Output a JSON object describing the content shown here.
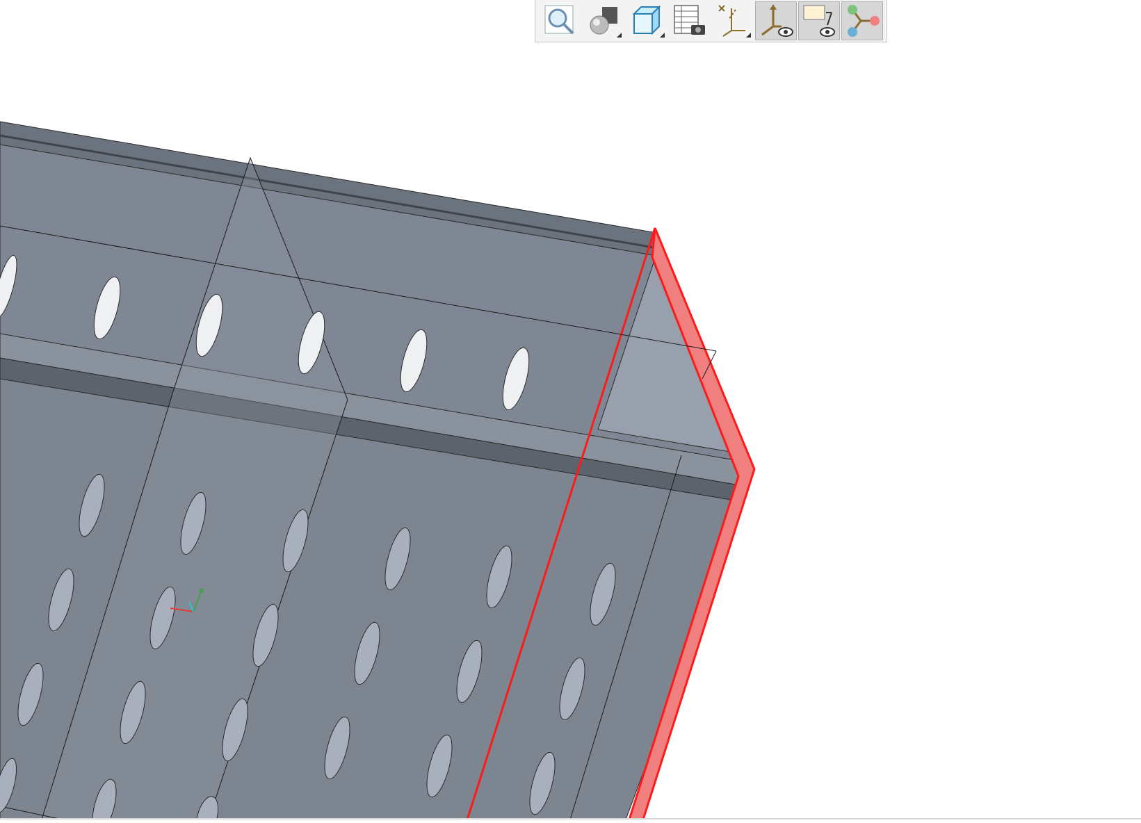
{
  "window": {
    "title": ""
  },
  "toolbar": {
    "buttons": [
      {
        "icon": "zoom-icon",
        "tooltip": "",
        "active": false
      },
      {
        "icon": "render-style-icon",
        "tooltip": "",
        "active": false,
        "flyout": true
      },
      {
        "icon": "view-cube-icon",
        "tooltip": "",
        "active": false,
        "flyout": true
      },
      {
        "icon": "table-camera-icon",
        "tooltip": "",
        "active": false
      },
      {
        "icon": "coordinate-axes-icon",
        "tooltip": "",
        "active": false,
        "flyout": true
      },
      {
        "icon": "axis-visibility-icon",
        "tooltip": "",
        "active": true
      },
      {
        "icon": "annotation-visibility-icon",
        "tooltip": "",
        "active": true
      },
      {
        "icon": "connection-nodes-icon",
        "tooltip": "",
        "active": true
      }
    ]
  },
  "colors": {
    "background": "#ffffff",
    "model_face": "#7e8692",
    "model_face_dark": "#5b626b",
    "model_face_light": "#98a1ad",
    "selection": "#ff1a1a",
    "selection_fill": "#f08080",
    "hole_fill": "#eef0f2"
  }
}
